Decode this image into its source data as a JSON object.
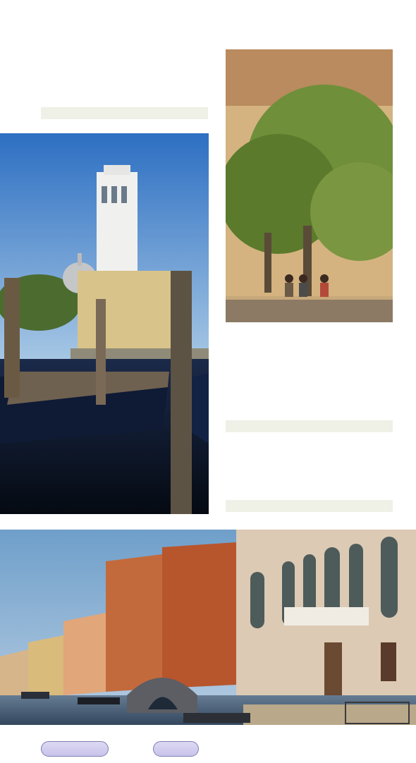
{
  "pages": {
    "images": [
      {
        "name": "church-bell-tower-photo"
      },
      {
        "name": "tree-square-photo"
      },
      {
        "name": "canal-buildings-photo"
      }
    ],
    "buttons": [
      {
        "label": ""
      },
      {
        "label": ""
      }
    ]
  }
}
